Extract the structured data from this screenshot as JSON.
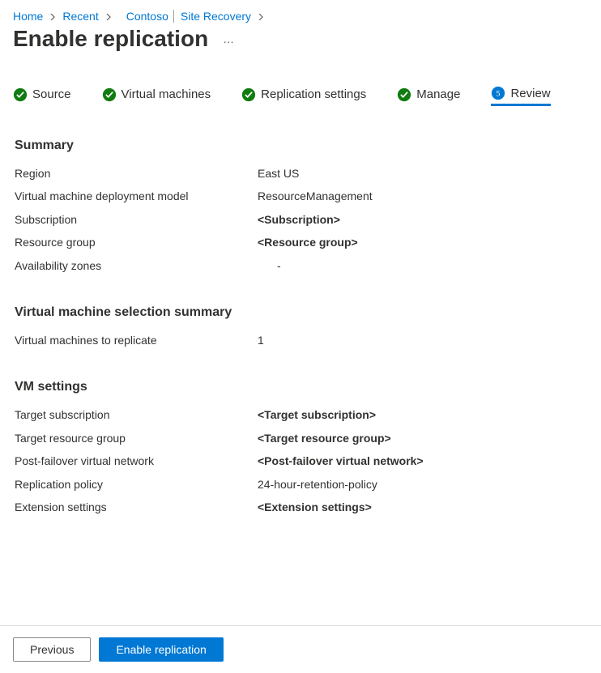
{
  "breadcrumb": {
    "home": "Home",
    "recent": "Recent",
    "resource": "Contoso",
    "context": "Site Recovery"
  },
  "page_title": "Enable replication",
  "steps": {
    "source": "Source",
    "vms": "Virtual machines",
    "replication": "Replication settings",
    "manage": "Manage",
    "review": "Review",
    "review_step_number": "5"
  },
  "summary": {
    "heading": "Summary",
    "region_label": "Region",
    "region_value": "East US",
    "deploy_model_label": "Virtual machine deployment model",
    "deploy_model_value": "ResourceManagement",
    "subscription_label": "Subscription",
    "subscription_value": "<Subscription>",
    "resource_group_label": "Resource group",
    "resource_group_value": "<Resource group>",
    "az_label": "Availability zones",
    "az_value": "-"
  },
  "vm_select": {
    "heading": "Virtual machine selection summary",
    "vms_label": "Virtual machines to replicate",
    "vms_value": "1"
  },
  "vm_settings": {
    "heading": "VM settings",
    "target_sub_label": "Target subscription",
    "target_sub_value": "<Target subscription>",
    "target_rg_label": "Target resource group",
    "target_rg_value": "<Target resource group>",
    "pfvn_label": "Post-failover virtual network",
    "pfvn_value": "<Post-failover virtual network>",
    "policy_label": "Replication policy",
    "policy_value": "24-hour-retention-policy",
    "ext_label": "Extension settings",
    "ext_value": "<Extension settings>"
  },
  "footer": {
    "previous": "Previous",
    "enable": "Enable replication"
  }
}
